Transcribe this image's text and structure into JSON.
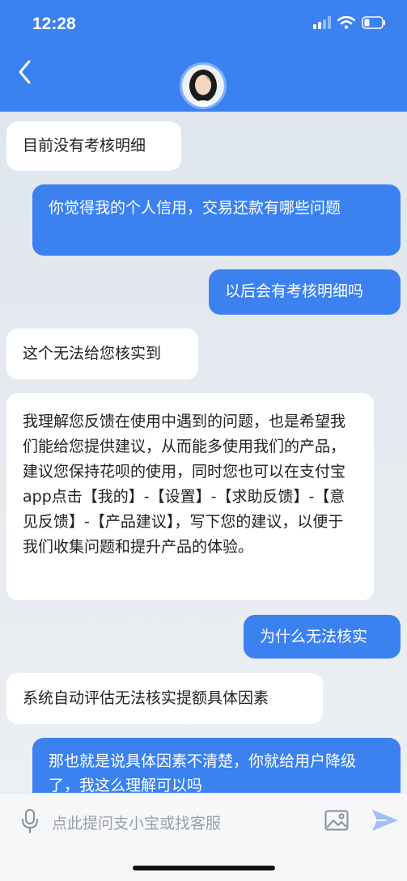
{
  "status_bar": {
    "time": "12:28"
  },
  "messages": [
    {
      "side": "left",
      "text": "目前没有考核明细"
    },
    {
      "side": "right",
      "text": "你觉得我的个人信用，交易还款有哪些问题"
    },
    {
      "side": "right",
      "text": "以后会有考核明细吗"
    },
    {
      "side": "left",
      "text": "这个无法给您核实到"
    },
    {
      "side": "left",
      "text": "我理解您反馈在使用中遇到的问题，也是希望我们能给您提供建议，从而能多使用我们的产品，建议您保持花呗的使用，同时您也可以在支付宝app点击【我的】-【设置】-【求助反馈】-【意见反馈】-【产品建议】，写下您的建议，以便于我们收集问题和提升产品的体验。"
    },
    {
      "side": "right",
      "text": "为什么无法核实"
    },
    {
      "side": "left",
      "text": "系统自动评估无法核实提额具体因素"
    },
    {
      "side": "right",
      "text": "那也就是说具体因素不清楚，你就给用户降级了，我这么理解可以吗"
    }
  ],
  "input": {
    "placeholder": "点此提问支小宝或找客服"
  },
  "icons": {
    "back": "chevron-left-icon",
    "avatar": "assistant-avatar",
    "voice": "microphone-icon",
    "image": "image-icon",
    "send": "send-icon"
  },
  "colors": {
    "accent": "#3b82f0",
    "bubble_left": "#ffffff",
    "chat_bg": "#e5eaef"
  }
}
